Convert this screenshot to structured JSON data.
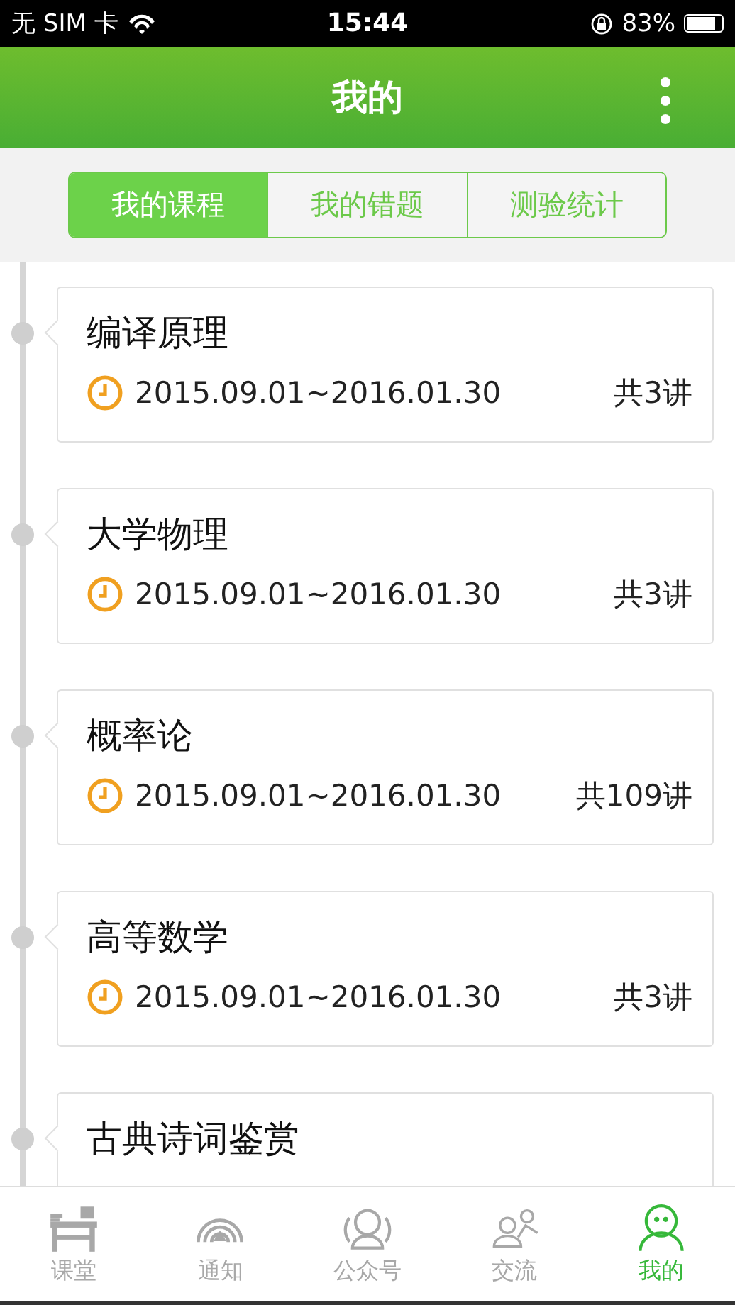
{
  "status_bar": {
    "carrier": "无 SIM 卡",
    "time": "15:44",
    "battery": "83%"
  },
  "header": {
    "title": "我的"
  },
  "tabs": [
    {
      "label": "我的课程",
      "selected": true
    },
    {
      "label": "我的错题",
      "selected": false
    },
    {
      "label": "测验统计",
      "selected": false
    }
  ],
  "courses": [
    {
      "title": "编译原理",
      "period": "2015.09.01~2016.01.30",
      "lectures": "共3讲"
    },
    {
      "title": "大学物理",
      "period": "2015.09.01~2016.01.30",
      "lectures": "共3讲"
    },
    {
      "title": "概率论",
      "period": "2015.09.01~2016.01.30",
      "lectures": "共109讲"
    },
    {
      "title": "高等数学",
      "period": "2015.09.01~2016.01.30",
      "lectures": "共3讲"
    },
    {
      "title": "古典诗词鉴赏"
    }
  ],
  "nav": [
    {
      "label": "课堂",
      "kind": "desk",
      "selected": false
    },
    {
      "label": "通知",
      "kind": "signal",
      "selected": false
    },
    {
      "label": "公众号",
      "kind": "person",
      "selected": false
    },
    {
      "label": "交流",
      "kind": "people",
      "selected": false
    },
    {
      "label": "我的",
      "kind": "face",
      "selected": true
    }
  ]
}
